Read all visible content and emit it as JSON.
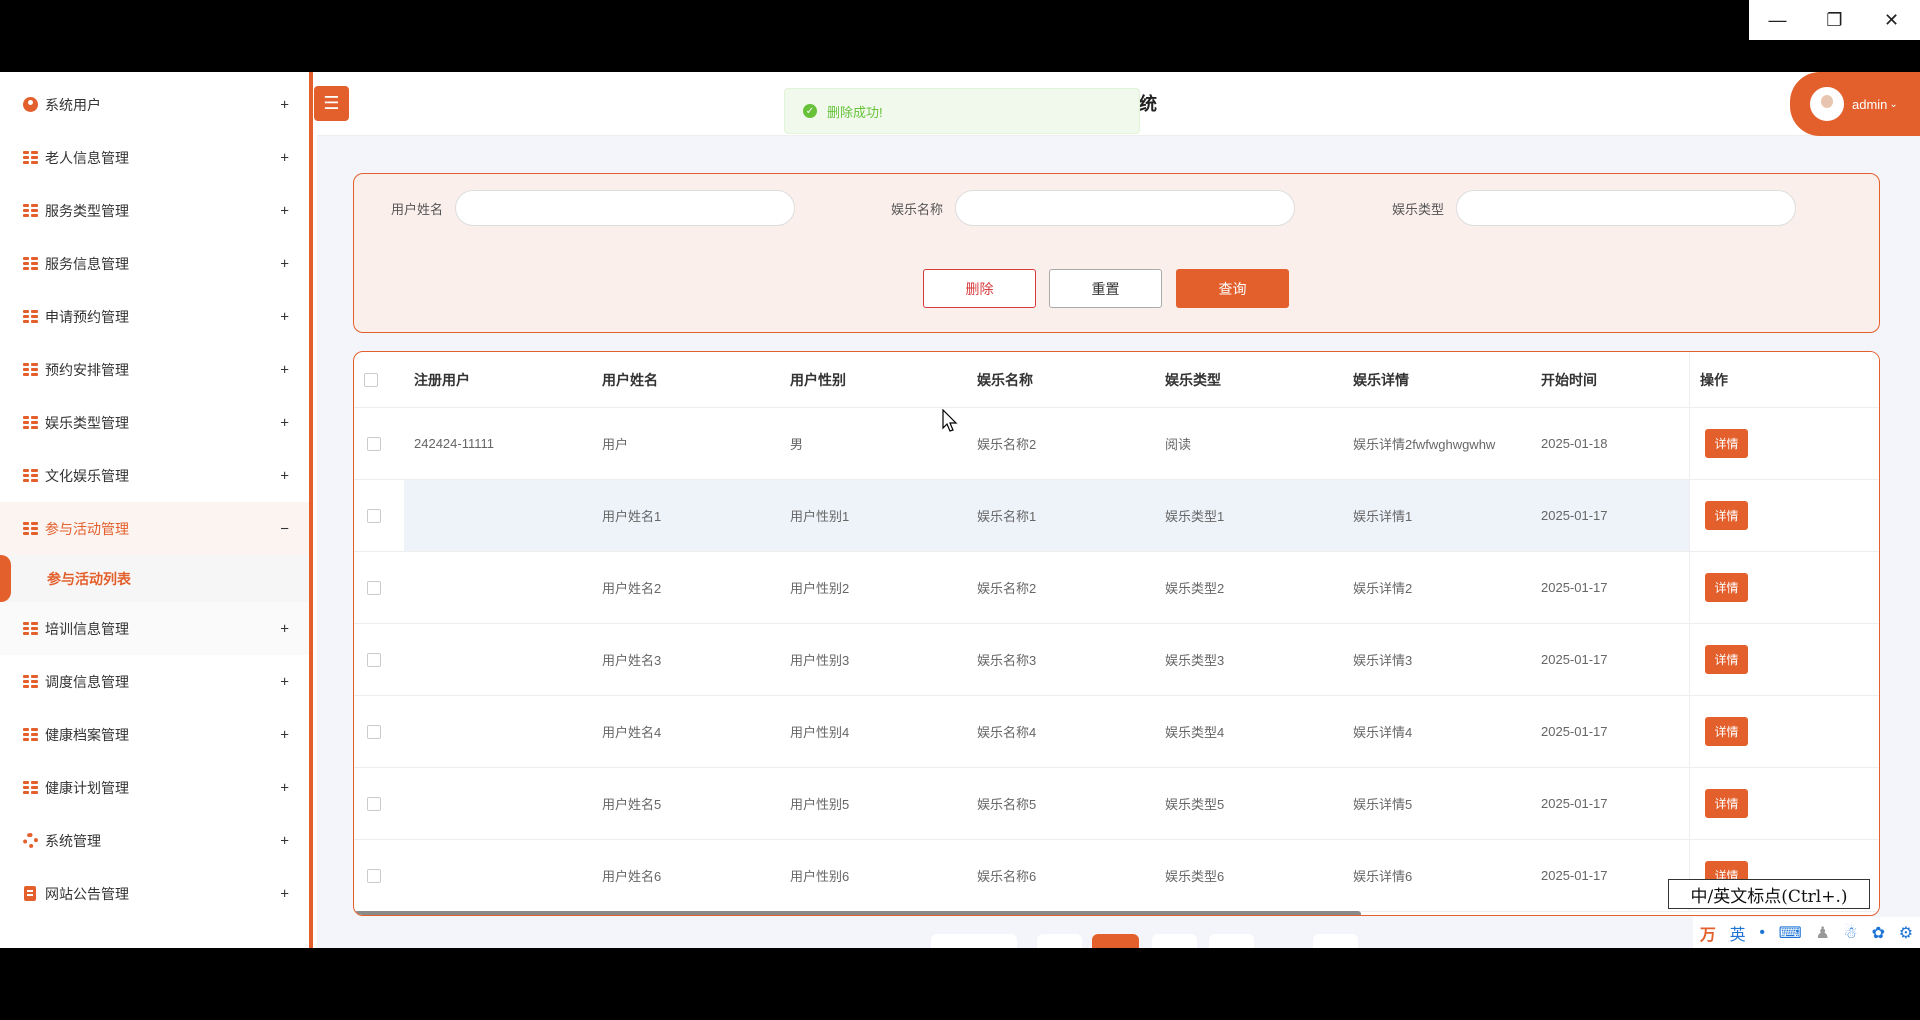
{
  "window": {
    "minimize_icon": "minimize-icon",
    "restore_icon": "restore-icon",
    "close_icon": "close-icon"
  },
  "header": {
    "title_suffix": "统",
    "user_name": "admin"
  },
  "toast": {
    "message": "删除成功!"
  },
  "sidebar": {
    "items": [
      {
        "label": "系统用户",
        "icon": "user-icon",
        "toggle": "+"
      },
      {
        "label": "老人信息管理",
        "icon": "grid-icon",
        "toggle": "+"
      },
      {
        "label": "服务类型管理",
        "icon": "grid-icon",
        "toggle": "+"
      },
      {
        "label": "服务信息管理",
        "icon": "grid-icon",
        "toggle": "+"
      },
      {
        "label": "申请预约管理",
        "icon": "grid-icon",
        "toggle": "+"
      },
      {
        "label": "预约安排管理",
        "icon": "grid-icon",
        "toggle": "+"
      },
      {
        "label": "娱乐类型管理",
        "icon": "grid-icon",
        "toggle": "+"
      },
      {
        "label": "文化娱乐管理",
        "icon": "grid-icon",
        "toggle": "+"
      },
      {
        "label": "参与活动管理",
        "icon": "grid-icon",
        "toggle": "−"
      },
      {
        "label": "培训信息管理",
        "icon": "grid-icon",
        "toggle": "+"
      },
      {
        "label": "调度信息管理",
        "icon": "grid-icon",
        "toggle": "+"
      },
      {
        "label": "健康档案管理",
        "icon": "grid-icon",
        "toggle": "+"
      },
      {
        "label": "健康计划管理",
        "icon": "grid-icon",
        "toggle": "+"
      },
      {
        "label": "系统管理",
        "icon": "gear-icon",
        "toggle": "+"
      },
      {
        "label": "网站公告管理",
        "icon": "doc-icon",
        "toggle": "+"
      }
    ],
    "sub_item": "参与活动列表"
  },
  "search": {
    "fields": [
      {
        "label": "用户姓名",
        "value": ""
      },
      {
        "label": "娱乐名称",
        "value": ""
      },
      {
        "label": "娱乐类型",
        "value": ""
      }
    ],
    "delete_label": "删除",
    "reset_label": "重置",
    "query_label": "查询"
  },
  "table": {
    "columns": [
      "注册用户",
      "用户姓名",
      "用户性别",
      "娱乐名称",
      "娱乐类型",
      "娱乐详情",
      "开始时间",
      "操作"
    ],
    "action_label": "详情",
    "rows": [
      [
        "242424-11111",
        "用户",
        "男",
        "娱乐名称2",
        "阅读",
        "娱乐详情2fwfwghwgwhw",
        "2025-01-18"
      ],
      [
        "",
        "用户姓名1",
        "用户性别1",
        "娱乐名称1",
        "娱乐类型1",
        "娱乐详情1",
        "2025-01-17"
      ],
      [
        "",
        "用户姓名2",
        "用户性别2",
        "娱乐名称2",
        "娱乐类型2",
        "娱乐详情2",
        "2025-01-17"
      ],
      [
        "",
        "用户姓名3",
        "用户性别3",
        "娱乐名称3",
        "娱乐类型3",
        "娱乐详情3",
        "2025-01-17"
      ],
      [
        "",
        "用户姓名4",
        "用户性别4",
        "娱乐名称4",
        "娱乐类型4",
        "娱乐详情4",
        "2025-01-17"
      ],
      [
        "",
        "用户姓名5",
        "用户性别5",
        "娱乐名称5",
        "娱乐类型5",
        "娱乐详情5",
        "2025-01-17"
      ],
      [
        "",
        "用户姓名6",
        "用户性别6",
        "娱乐名称6",
        "娱乐类型6",
        "娱乐详情6",
        "2025-01-17"
      ]
    ]
  },
  "ime": {
    "tip": "中/英文标点(Ctrl+.)",
    "mode": "英"
  },
  "colors": {
    "accent": "#e3602d",
    "success": "#67c23a",
    "danger": "#d83c3c"
  }
}
